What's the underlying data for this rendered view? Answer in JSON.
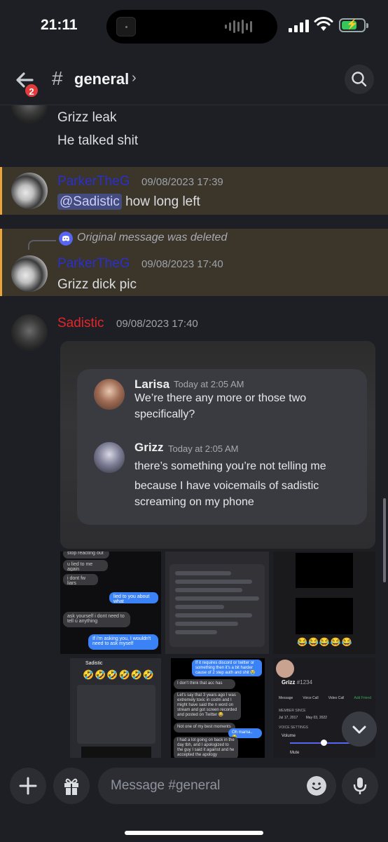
{
  "status_bar": {
    "time": "21:11"
  },
  "header": {
    "back_badge": "2",
    "hash": "#",
    "channel_name": "general",
    "chevron": "›"
  },
  "messages": [
    {
      "id": "m1",
      "lines": [
        "Grizz leak",
        "He talked shit"
      ]
    },
    {
      "id": "m2",
      "author": "ParkerTheG",
      "timestamp": "09/08/2023 17:39",
      "mention": "@Sadistic",
      "text": " how long left"
    },
    {
      "id": "m3",
      "reply": "Original message was deleted",
      "author": "ParkerTheG",
      "timestamp": "09/08/2023 17:40",
      "text": "Grizz dick pic"
    },
    {
      "id": "m4",
      "author": "Sadistic",
      "timestamp": "09/08/2023 17:40"
    }
  ],
  "embedded_image": {
    "larisa_name": "Larisa",
    "larisa_time": "Today at 2:05 AM",
    "larisa_text_1": "We’re there any more or those two",
    "larisa_text_2": "specifically?",
    "grizz_name": "Grizz",
    "grizz_time": "Today at 2:05 AM",
    "grizz_text_1": "there’s something you’re not telling me",
    "grizz_text_2": "because I have voicemails of sadistic",
    "grizz_text_3": "screaming on my phone"
  },
  "grid_texts": {
    "t1_a": "stop reacting out",
    "t1_b": "u lied to me again",
    "t1_c": "i dont fw liars",
    "t1_d": "lied to you about what",
    "t1_e": "ask yourself i dont need to tell u anything",
    "t1_f": "If i'm asking you, I wouldn't need to ask myself",
    "t5_title": "Sadistic",
    "t6_a": "If it requires discord or twitter or something then it's a bit harder cause of 2 step auth and shit 😭",
    "t6_b": "I don't think that acc has",
    "t6_c": "Let's say that 3 years ago I was extremely toxic in codm and I might have said the n word on stream and got screen recorded and posted on Twitter 😂",
    "t6_d": "Not one of my best moments",
    "t6_e": "Oh mama.. 😂",
    "t6_f": "I had a lot going on back in the day tbh, and I apologized to the guy I said it against and he accepted the apology",
    "t7_name": "Grizz",
    "t7_tag": "#1234",
    "t7_member": "MEMBER SINCE",
    "t7_date1": "Jul 17, 2017",
    "t7_date2": "May 03, 2022",
    "t7_voice": "VOICE SETTINGS",
    "t7_volume": "Volume",
    "t7_mute": "Mute",
    "t7_msg": "Message",
    "t7_vcall": "Voice Call",
    "t7_video": "Video Call",
    "t7_add": "Add Friend"
  },
  "emoji_rows": {
    "row1": "😂😂😂😂😂",
    "row2": "🤣🤣🤣🤣🤣🤣"
  },
  "composer": {
    "placeholder": "Message #general"
  },
  "colors": {
    "username_parker": "#2a2fcf",
    "username_sadistic": "#e2262b",
    "highlight_bg": "#3b352a",
    "highlight_bar": "#e8a53a",
    "mention_bg": "#444b7d"
  }
}
